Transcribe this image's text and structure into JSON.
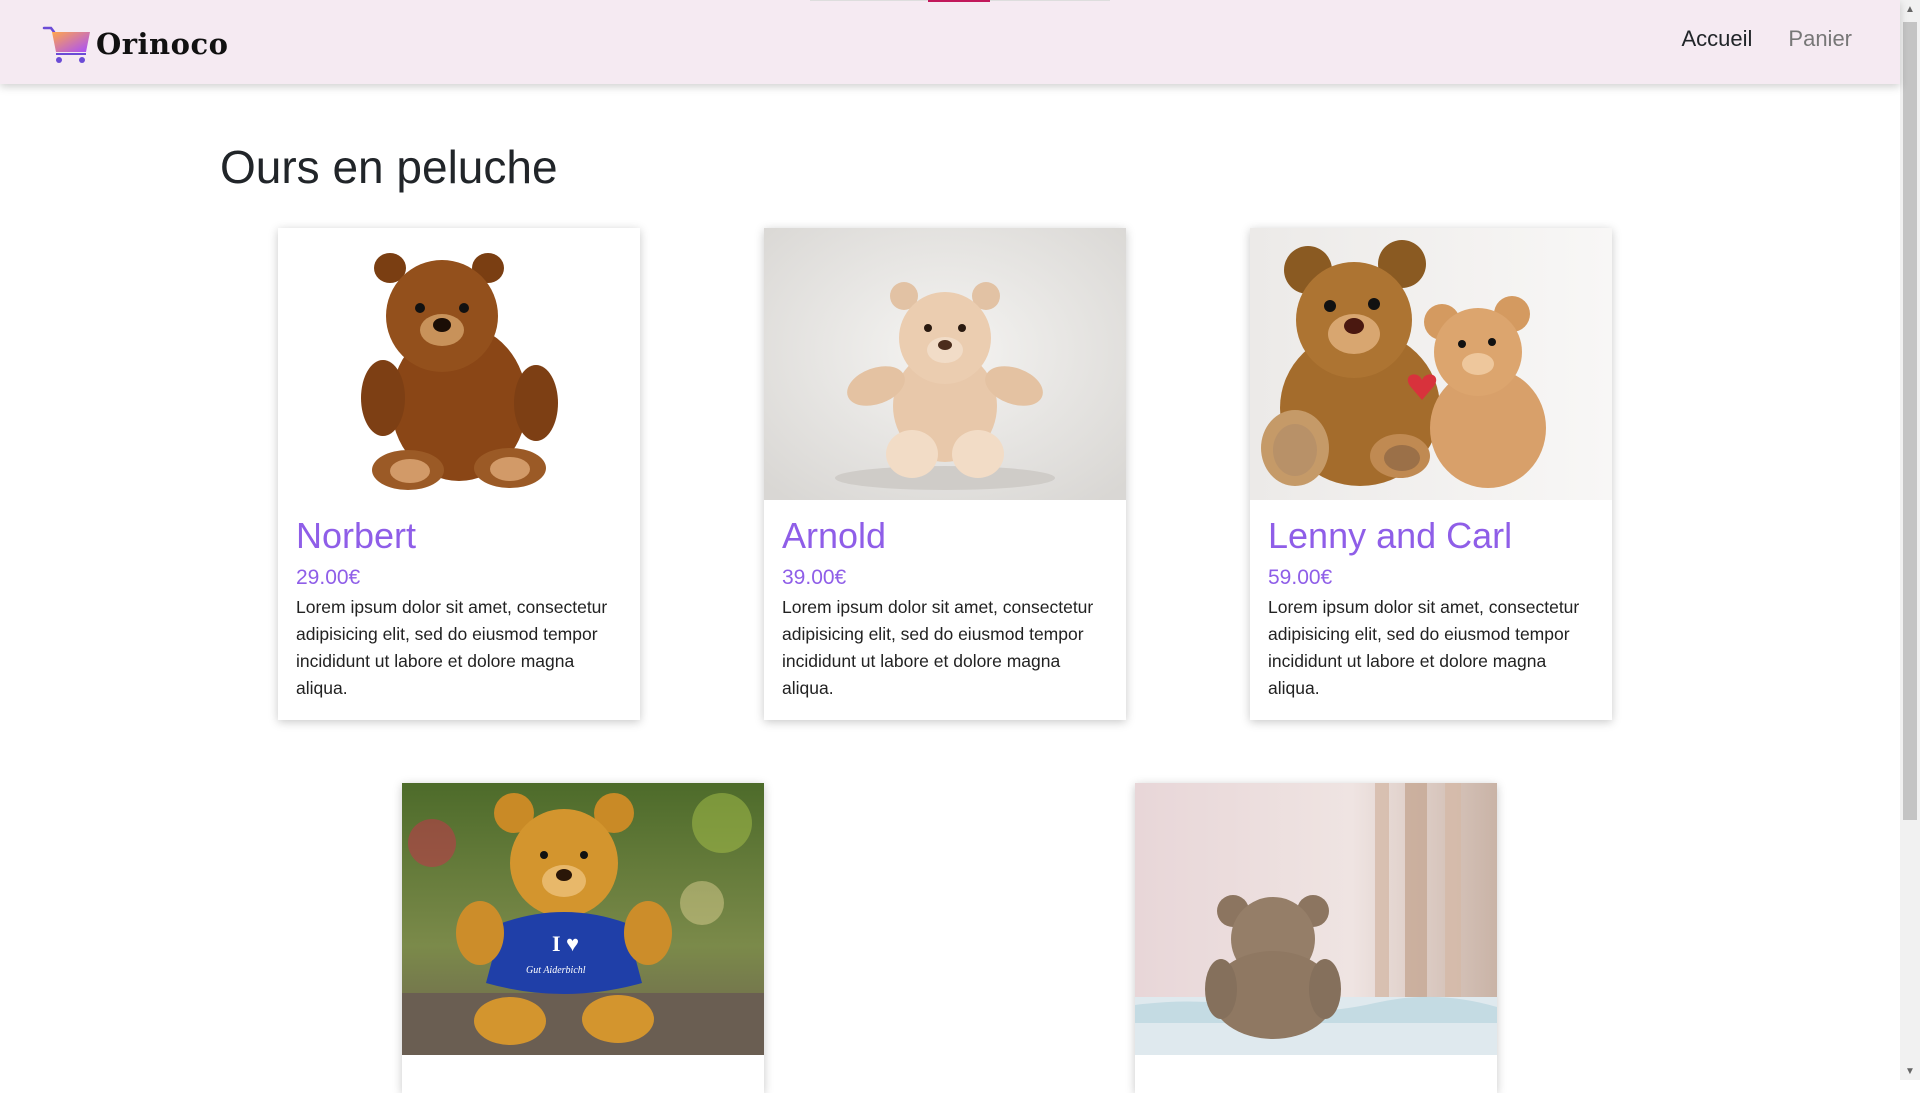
{
  "navbar": {
    "brand": "Orinoco",
    "links": [
      {
        "label": "Accueil",
        "active": true
      },
      {
        "label": "Panier",
        "active": false
      }
    ]
  },
  "page_title": "Ours en peluche",
  "colors": {
    "navbar_bg": "#f5eaf2",
    "accent_purple": "#8f5ee8",
    "logo_gradient": [
      "#ffa64d",
      "#a64dff"
    ]
  },
  "products": [
    {
      "name": "Norbert",
      "price": "29.00€",
      "description": "Lorem ipsum dolor sit amet, consectetur adipisicing elit, sed do eiusmod tempor incididunt ut labore et dolore magna aliqua.",
      "image": "brown-teddy-bear-photo"
    },
    {
      "name": "Arnold",
      "price": "39.00€",
      "description": "Lorem ipsum dolor sit amet, consectetur adipisicing elit, sed do eiusmod tempor incididunt ut labore et dolore magna aliqua.",
      "image": "beige-teddy-bear-photo"
    },
    {
      "name": "Lenny and Carl",
      "price": "59.00€",
      "description": "Lorem ipsum dolor sit amet, consectetur adipisicing elit, sed do eiusmod tempor incididunt ut labore et dolore magna aliqua.",
      "image": "two-teddy-bears-photo"
    },
    {
      "name": "",
      "price": "",
      "description": "",
      "image": "teddy-bear-blue-shirt-photo",
      "shirt_text": "I ♥",
      "shirt_subtext": "Gut Aiderbichl"
    },
    {
      "name": "",
      "price": "",
      "description": "",
      "image": "teddy-bear-back-view-photo"
    }
  ]
}
